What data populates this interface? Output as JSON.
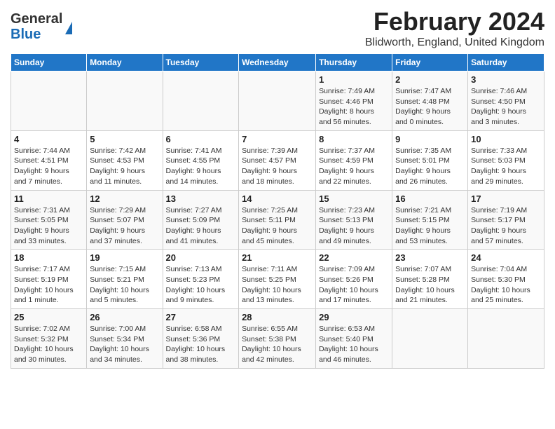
{
  "header": {
    "logo_general": "General",
    "logo_blue": "Blue",
    "title": "February 2024",
    "subtitle": "Blidworth, England, United Kingdom"
  },
  "days_of_week": [
    "Sunday",
    "Monday",
    "Tuesday",
    "Wednesday",
    "Thursday",
    "Friday",
    "Saturday"
  ],
  "weeks": [
    [
      {
        "day": "",
        "info": ""
      },
      {
        "day": "",
        "info": ""
      },
      {
        "day": "",
        "info": ""
      },
      {
        "day": "",
        "info": ""
      },
      {
        "day": "1",
        "info": "Sunrise: 7:49 AM\nSunset: 4:46 PM\nDaylight: 8 hours\nand 56 minutes."
      },
      {
        "day": "2",
        "info": "Sunrise: 7:47 AM\nSunset: 4:48 PM\nDaylight: 9 hours\nand 0 minutes."
      },
      {
        "day": "3",
        "info": "Sunrise: 7:46 AM\nSunset: 4:50 PM\nDaylight: 9 hours\nand 3 minutes."
      }
    ],
    [
      {
        "day": "4",
        "info": "Sunrise: 7:44 AM\nSunset: 4:51 PM\nDaylight: 9 hours\nand 7 minutes."
      },
      {
        "day": "5",
        "info": "Sunrise: 7:42 AM\nSunset: 4:53 PM\nDaylight: 9 hours\nand 11 minutes."
      },
      {
        "day": "6",
        "info": "Sunrise: 7:41 AM\nSunset: 4:55 PM\nDaylight: 9 hours\nand 14 minutes."
      },
      {
        "day": "7",
        "info": "Sunrise: 7:39 AM\nSunset: 4:57 PM\nDaylight: 9 hours\nand 18 minutes."
      },
      {
        "day": "8",
        "info": "Sunrise: 7:37 AM\nSunset: 4:59 PM\nDaylight: 9 hours\nand 22 minutes."
      },
      {
        "day": "9",
        "info": "Sunrise: 7:35 AM\nSunset: 5:01 PM\nDaylight: 9 hours\nand 26 minutes."
      },
      {
        "day": "10",
        "info": "Sunrise: 7:33 AM\nSunset: 5:03 PM\nDaylight: 9 hours\nand 29 minutes."
      }
    ],
    [
      {
        "day": "11",
        "info": "Sunrise: 7:31 AM\nSunset: 5:05 PM\nDaylight: 9 hours\nand 33 minutes."
      },
      {
        "day": "12",
        "info": "Sunrise: 7:29 AM\nSunset: 5:07 PM\nDaylight: 9 hours\nand 37 minutes."
      },
      {
        "day": "13",
        "info": "Sunrise: 7:27 AM\nSunset: 5:09 PM\nDaylight: 9 hours\nand 41 minutes."
      },
      {
        "day": "14",
        "info": "Sunrise: 7:25 AM\nSunset: 5:11 PM\nDaylight: 9 hours\nand 45 minutes."
      },
      {
        "day": "15",
        "info": "Sunrise: 7:23 AM\nSunset: 5:13 PM\nDaylight: 9 hours\nand 49 minutes."
      },
      {
        "day": "16",
        "info": "Sunrise: 7:21 AM\nSunset: 5:15 PM\nDaylight: 9 hours\nand 53 minutes."
      },
      {
        "day": "17",
        "info": "Sunrise: 7:19 AM\nSunset: 5:17 PM\nDaylight: 9 hours\nand 57 minutes."
      }
    ],
    [
      {
        "day": "18",
        "info": "Sunrise: 7:17 AM\nSunset: 5:19 PM\nDaylight: 10 hours\nand 1 minute."
      },
      {
        "day": "19",
        "info": "Sunrise: 7:15 AM\nSunset: 5:21 PM\nDaylight: 10 hours\nand 5 minutes."
      },
      {
        "day": "20",
        "info": "Sunrise: 7:13 AM\nSunset: 5:23 PM\nDaylight: 10 hours\nand 9 minutes."
      },
      {
        "day": "21",
        "info": "Sunrise: 7:11 AM\nSunset: 5:25 PM\nDaylight: 10 hours\nand 13 minutes."
      },
      {
        "day": "22",
        "info": "Sunrise: 7:09 AM\nSunset: 5:26 PM\nDaylight: 10 hours\nand 17 minutes."
      },
      {
        "day": "23",
        "info": "Sunrise: 7:07 AM\nSunset: 5:28 PM\nDaylight: 10 hours\nand 21 minutes."
      },
      {
        "day": "24",
        "info": "Sunrise: 7:04 AM\nSunset: 5:30 PM\nDaylight: 10 hours\nand 25 minutes."
      }
    ],
    [
      {
        "day": "25",
        "info": "Sunrise: 7:02 AM\nSunset: 5:32 PM\nDaylight: 10 hours\nand 30 minutes."
      },
      {
        "day": "26",
        "info": "Sunrise: 7:00 AM\nSunset: 5:34 PM\nDaylight: 10 hours\nand 34 minutes."
      },
      {
        "day": "27",
        "info": "Sunrise: 6:58 AM\nSunset: 5:36 PM\nDaylight: 10 hours\nand 38 minutes."
      },
      {
        "day": "28",
        "info": "Sunrise: 6:55 AM\nSunset: 5:38 PM\nDaylight: 10 hours\nand 42 minutes."
      },
      {
        "day": "29",
        "info": "Sunrise: 6:53 AM\nSunset: 5:40 PM\nDaylight: 10 hours\nand 46 minutes."
      },
      {
        "day": "",
        "info": ""
      },
      {
        "day": "",
        "info": ""
      }
    ]
  ]
}
